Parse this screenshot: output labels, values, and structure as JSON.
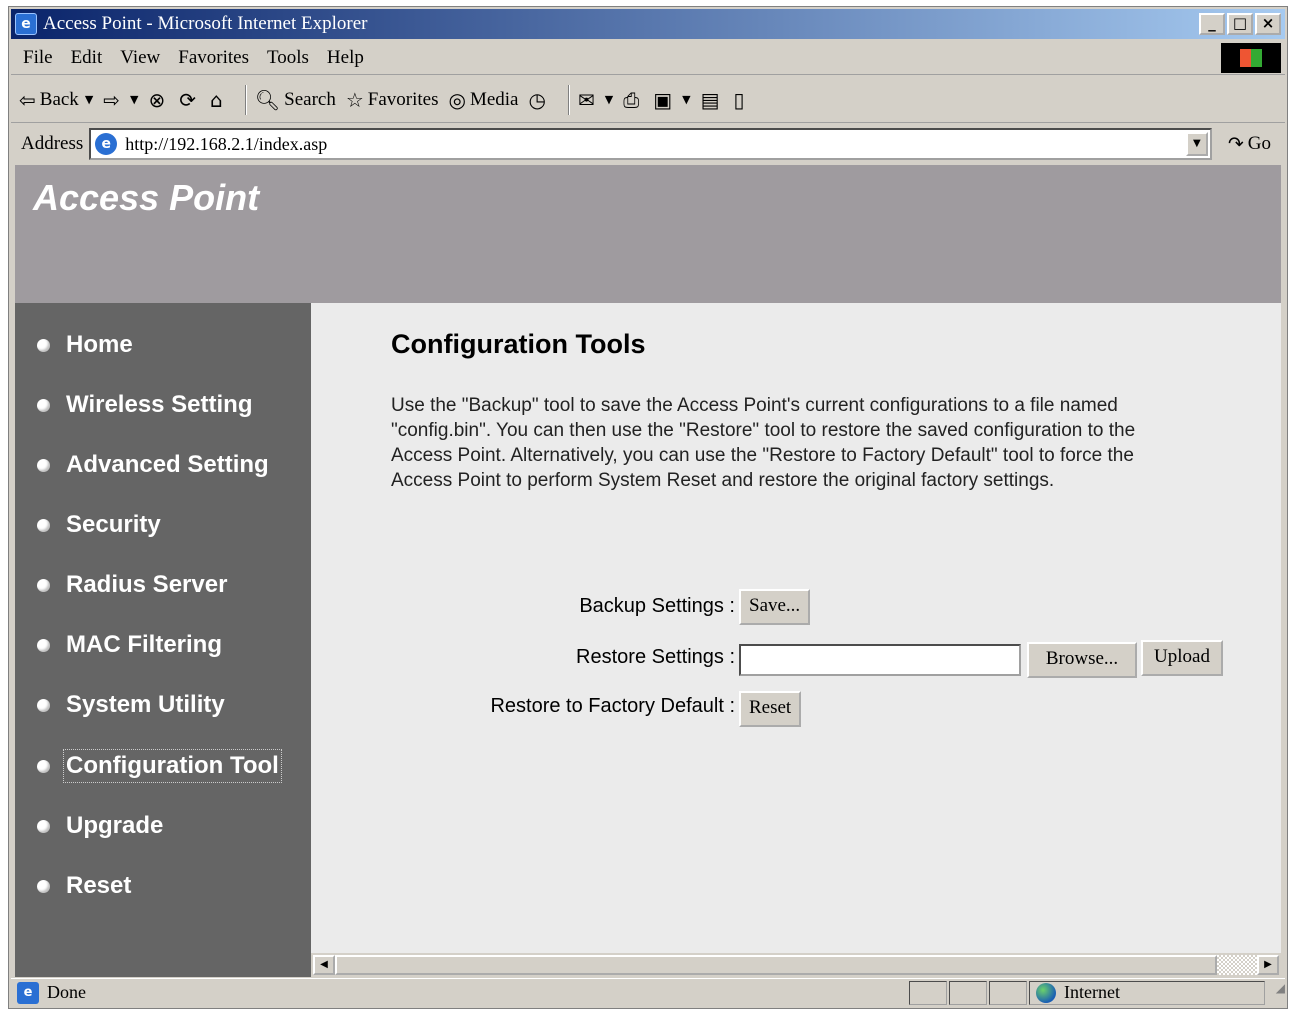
{
  "window": {
    "title": "Access Point - Microsoft Internet Explorer",
    "controls": {
      "minimize": "_",
      "maximize": "□",
      "close": "×"
    }
  },
  "menu": [
    "File",
    "Edit",
    "View",
    "Favorites",
    "Tools",
    "Help"
  ],
  "toolbar": {
    "back_label": "Back",
    "search_label": "Search",
    "favorites_label": "Favorites",
    "media_label": "Media"
  },
  "address": {
    "label": "Address",
    "url": "http://192.168.2.1/index.asp",
    "go_label": "Go"
  },
  "banner": {
    "title": "Access Point"
  },
  "sidebar": {
    "items": [
      {
        "label": "Home"
      },
      {
        "label": "Wireless Setting"
      },
      {
        "label": "Advanced Setting"
      },
      {
        "label": "Security"
      },
      {
        "label": "Radius Server"
      },
      {
        "label": "MAC Filtering"
      },
      {
        "label": "System Utility"
      },
      {
        "label": "Configuration Tool",
        "active": true
      },
      {
        "label": "Upgrade"
      },
      {
        "label": "Reset"
      }
    ]
  },
  "main": {
    "title": "Configuration Tools",
    "description": "Use the \"Backup\" tool to save the Access Point's current configurations to a file named \"config.bin\". You can then use the \"Restore\" tool to restore the saved configuration to the Access Point. Alternatively, you can use the \"Restore to Factory Default\" tool to force the Access Point to perform System Reset and restore the original factory settings.",
    "backup": {
      "label": "Backup Settings :",
      "button": "Save..."
    },
    "restore": {
      "label": "Restore Settings :",
      "file_value": "",
      "browse_button": "Browse...",
      "upload_button": "Upload"
    },
    "factory": {
      "label": "Restore to Factory Default :",
      "button": "Reset"
    }
  },
  "status": {
    "text": "Done",
    "zone": "Internet"
  },
  "colors": {
    "banner": "#9f9b9f",
    "sidebar": "#656565",
    "content_bg": "#ebebeb",
    "titlebar_start": "#0a246a"
  }
}
